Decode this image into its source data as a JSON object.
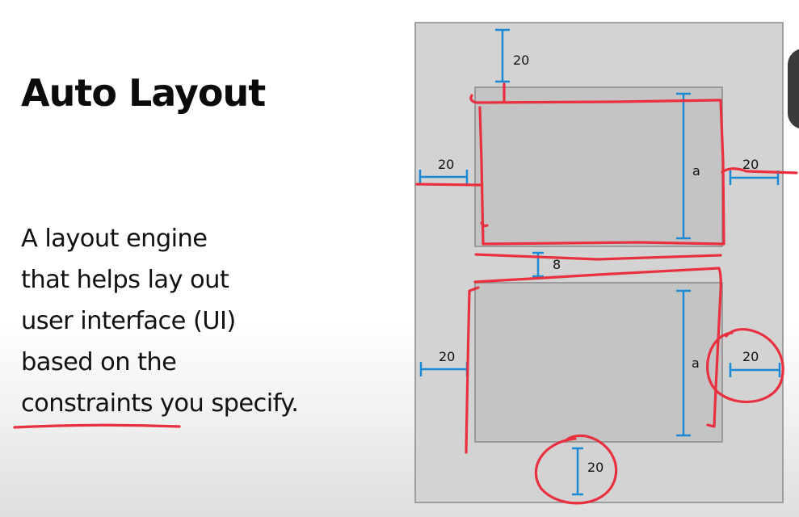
{
  "slide": {
    "title": "Auto Layout",
    "body_lines": [
      "A layout engine",
      "that helps lay out",
      "user interface (UI)",
      "based on the",
      "constraints you specify."
    ]
  },
  "diagram": {
    "top_margin": "20",
    "top_box": {
      "left_margin": "20",
      "right_margin": "20",
      "height": "a"
    },
    "gap": "8",
    "bottom_box": {
      "left_margin": "20",
      "right_margin": "20",
      "height": "a"
    },
    "bottom_margin": "20"
  },
  "colors": {
    "dimension_blue": "#1a8ad4",
    "annotation_red": "#e8303f",
    "container_fill": "#d3d3d3",
    "box_fill": "#c4c4c4",
    "outline": "#8a8a8a"
  }
}
